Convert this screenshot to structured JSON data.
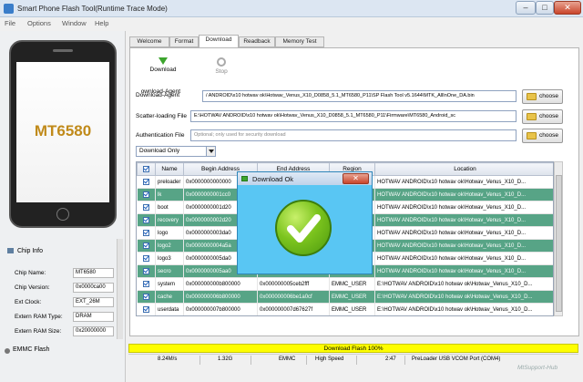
{
  "window": {
    "title": "Smart Phone Flash Tool(Runtime Trace Mode)"
  },
  "menu": [
    "File",
    "Options",
    "Window",
    "Help"
  ],
  "phone": {
    "model": "MT6580"
  },
  "chip_info": {
    "header": "Chip Info",
    "rows": [
      {
        "label": "Chip Name:",
        "value": "MT6580"
      },
      {
        "label": "Chip Version:",
        "value": "0x0000ca00"
      },
      {
        "label": "Ext Clock:",
        "value": "EXT_26M"
      },
      {
        "label": "Extern RAM Type:",
        "value": "DRAM"
      },
      {
        "label": "Extern RAM Size:",
        "value": "0x20000000"
      }
    ],
    "storage": "EMMC Flash"
  },
  "tabs": [
    "Welcome",
    "Format",
    "Download",
    "Readback",
    "Memory Test"
  ],
  "toolbar": {
    "download": "Download",
    "stop": "Stop"
  },
  "fields": {
    "download_agent": {
      "label": "Download-Agent",
      "value": "/ ANDROID\\x10 hotwav ok\\Hotwav_Venus_X10_D0858_5.1_MT6580_P11\\SP Flash Tool v5.1644\\MTK_AllInOne_DA.bin"
    },
    "scatter": {
      "label": "Scatter-loading File",
      "value": "E:\\HOTWAV ANDROID\\x10 hotwav ok\\Hotwav_Venus_X10_D0858_5.1_MT6580_P11\\Firmware\\MT6580_Android_sc"
    },
    "auth": {
      "label": "Authentication File",
      "placeholder": "Optional; only used for security download"
    },
    "choose_label": "choose"
  },
  "mode_select": "Download Only",
  "table": {
    "headers": [
      "",
      "Name",
      "Begin Address",
      "End Address",
      "Region",
      "Location"
    ],
    "rows": [
      {
        "name": "preloader",
        "begin": "0x0000000000000",
        "end": "",
        "region": "",
        "location": "HOTWAV ANDROID\\x10 hotwav ok\\Hotwav_Venus_X10_D...",
        "hl": false
      },
      {
        "name": "lk",
        "begin": "0x0000000001cc0",
        "end": "",
        "region": "",
        "location": "HOTWAV ANDROID\\x10 hotwav ok\\Hotwav_Venus_X10_D...",
        "hl": true
      },
      {
        "name": "boot",
        "begin": "0x0000000001d20",
        "end": "",
        "region": "",
        "location": "HOTWAV ANDROID\\x10 hotwav ok\\Hotwav_Venus_X10_D...",
        "hl": false
      },
      {
        "name": "recovery",
        "begin": "0x0000000002d20",
        "end": "",
        "region": "",
        "location": "HOTWAV ANDROID\\x10 hotwav ok\\Hotwav_Venus_X10_D...",
        "hl": true
      },
      {
        "name": "logo",
        "begin": "0x0000000003da0",
        "end": "",
        "region": "",
        "location": "HOTWAV ANDROID\\x10 hotwav ok\\Hotwav_Venus_X10_D...",
        "hl": false
      },
      {
        "name": "logo2",
        "begin": "0x0000000004a5a",
        "end": "",
        "region": "",
        "location": "HOTWAV ANDROID\\x10 hotwav ok\\Hotwav_Venus_X10_D...",
        "hl": true
      },
      {
        "name": "logo3",
        "begin": "0x0000000005da0",
        "end": "",
        "region": "",
        "location": "HOTWAV ANDROID\\x10 hotwav ok\\Hotwav_Venus_X10_D...",
        "hl": false
      },
      {
        "name": "secro",
        "begin": "0x0000000005aa0",
        "end": "",
        "region": "",
        "location": "HOTWAV ANDROID\\x10 hotwav ok\\Hotwav_Venus_X10_D...",
        "hl": true
      },
      {
        "name": "system",
        "begin": "0x000000000b800000",
        "end": "0x000000005ceb2fff",
        "region": "EMMC_USER",
        "location": "E:\\HOTWAV ANDROID\\x10 hotwav ok\\Hotwav_Venus_X10_D...",
        "hl": false
      },
      {
        "name": "cache",
        "begin": "0x000000006b800000",
        "end": "0x000000006be1a0cf",
        "region": "EMMC_USER",
        "location": "E:\\HOTWAV ANDROID\\x10 hotwav ok\\Hotwav_Venus_X10_D...",
        "hl": true
      },
      {
        "name": "userdata",
        "begin": "0x000000007b800000",
        "end": "0x000000007d67627f",
        "region": "EMMC_USER",
        "location": "E:\\HOTWAV ANDROID\\x10 hotwav ok\\Hotwav_Venus_X10_D...",
        "hl": false
      }
    ]
  },
  "progress": {
    "label": "Download Flash 100%",
    "percent": 100
  },
  "status": {
    "speed": "8.24M/s",
    "size": "1.32G",
    "storage": "EMMC",
    "speed_mode": "High Speed",
    "time": "2:47",
    "port": "PreLoader USB VCOM Port (COM4)"
  },
  "dialog": {
    "title": "Download Ok"
  },
  "watermark": "MtSupport-Hub",
  "colors": {
    "highlight_row": "#57a486",
    "progress": "#fefe00",
    "dialog_bg": "#59c6f3"
  }
}
